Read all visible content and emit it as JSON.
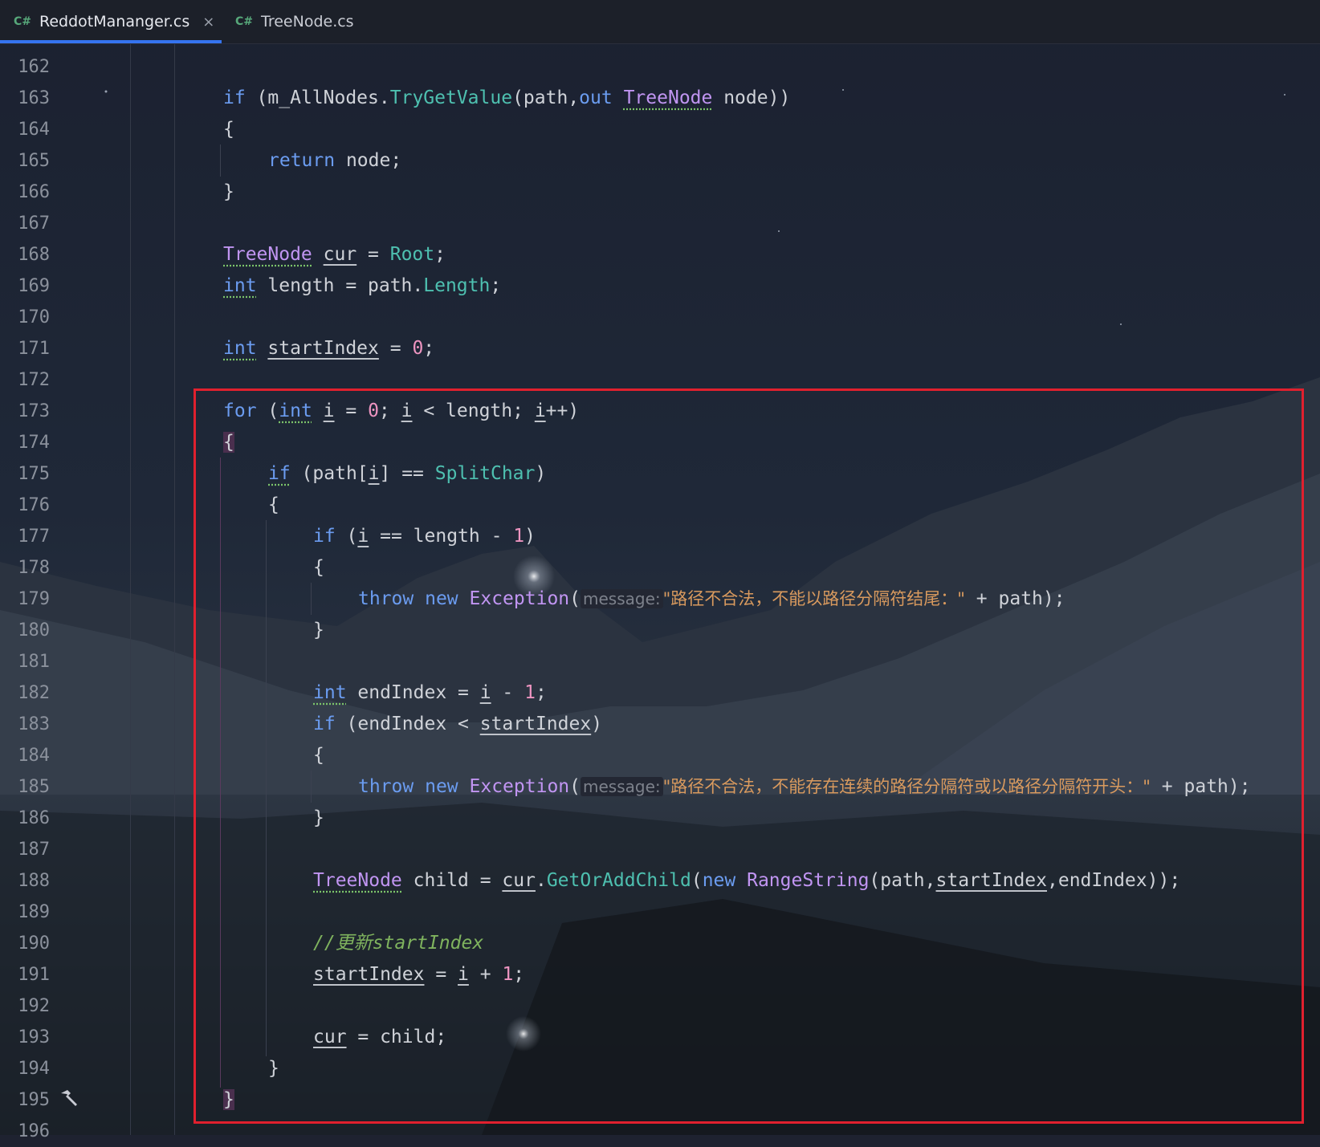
{
  "tabs": [
    {
      "lang": "C#",
      "label": "ReddotMananger.cs",
      "active": true,
      "close": "×"
    },
    {
      "lang": "C#",
      "label": "TreeNode.cs",
      "active": false
    }
  ],
  "line_numbers": [
    "162",
    "163",
    "164",
    "165",
    "166",
    "167",
    "168",
    "169",
    "170",
    "171",
    "172",
    "173",
    "174",
    "175",
    "176",
    "177",
    "178",
    "179",
    "180",
    "181",
    "182",
    "183",
    "184",
    "185",
    "186",
    "187",
    "188",
    "189",
    "190",
    "191",
    "192",
    "193",
    "194",
    "195",
    "196"
  ],
  "code": {
    "l163": {
      "kw_if": "if",
      "p1": " (",
      "var": "m_AllNodes",
      ".": ".",
      "method": "TryGetValue",
      "p2": "(path,",
      "kw_out": "out",
      "sp": " ",
      "type": "TreeNode",
      "rest": " node))"
    },
    "l164": "{",
    "l165": {
      "kw": "return",
      "rest": " node;"
    },
    "l166": "}",
    "l168": {
      "type": "TreeNode",
      "sp": " ",
      "var": "cur",
      "eq": " = ",
      "val": "Root",
      "end": ";"
    },
    "l169": {
      "type": "int",
      "rest": " length = path.",
      "prop": "Length",
      "end": ";"
    },
    "l171": {
      "type": "int",
      "sp": " ",
      "var": "startIndex",
      "eq": " = ",
      "num": "0",
      "end": ";"
    },
    "l173": {
      "kw": "for",
      "p1": " (",
      "type": "int",
      "sp": " ",
      "v1": "i",
      "eq": " = ",
      "num": "0",
      "s1": "; ",
      "v2": "i",
      "lt": " < length; ",
      "v3": "i",
      "end": "++)"
    },
    "l174": "{",
    "l175": {
      "kw": "if",
      "p1": " (path[",
      "v": "i",
      "p2": "] == ",
      "const": "SplitChar",
      "end": ")"
    },
    "l176": "{",
    "l177": {
      "kw": "if",
      "p1": " (",
      "v": "i",
      "p2": " == length - ",
      "num": "1",
      "end": ")"
    },
    "l178": "{",
    "l179": {
      "kw1": "throw",
      "kw2": "new",
      "type": "Exception",
      "p": "(",
      "hint": "message:",
      "str": "\"路径不合法，不能以路径分隔符结尾：\"",
      "rest": " + path);"
    },
    "l180": "}",
    "l182": {
      "type": "int",
      "rest": " endIndex = ",
      "v": "i",
      "m": " - ",
      "num": "1",
      "end": ";"
    },
    "l183": {
      "kw": "if",
      "p1": " (endIndex < ",
      "v": "startIndex",
      "end": ")"
    },
    "l184": "{",
    "l185": {
      "kw1": "throw",
      "kw2": "new",
      "type": "Exception",
      "p": "(",
      "hint": "message:",
      "str": "\"路径不合法，不能存在连续的路径分隔符或以路径分隔符开头：\"",
      "rest": " + path);"
    },
    "l186": "}",
    "l188": {
      "type": "TreeNode",
      "rest": " child = ",
      "v": "cur",
      ".": ".",
      "method": "GetOrAddChild",
      "p1": "(",
      "kw": "new",
      "sp": " ",
      "ctor": "RangeString",
      "p2": "(path,",
      "v2": "startIndex",
      "end": ",endIndex));"
    },
    "l190": "//更新startIndex",
    "l191": {
      "v": "startIndex",
      "eq": " = ",
      "v2": "i",
      "p": " + ",
      "num": "1",
      "end": ";"
    },
    "l193": {
      "v": "cur",
      "rest": " = child;"
    },
    "l194": "}",
    "l195": "}"
  },
  "colors": {
    "keyword": "#6b9cf0",
    "type": "#c195f2",
    "method": "#4ec0b0",
    "number": "#ed94c0",
    "string": "#d99a5e",
    "comment": "#7fb35e",
    "highlight_box": "#e0202e",
    "tab_underline": "#3574f0"
  },
  "icons": {
    "gutter_line_195": "hammer-icon"
  }
}
